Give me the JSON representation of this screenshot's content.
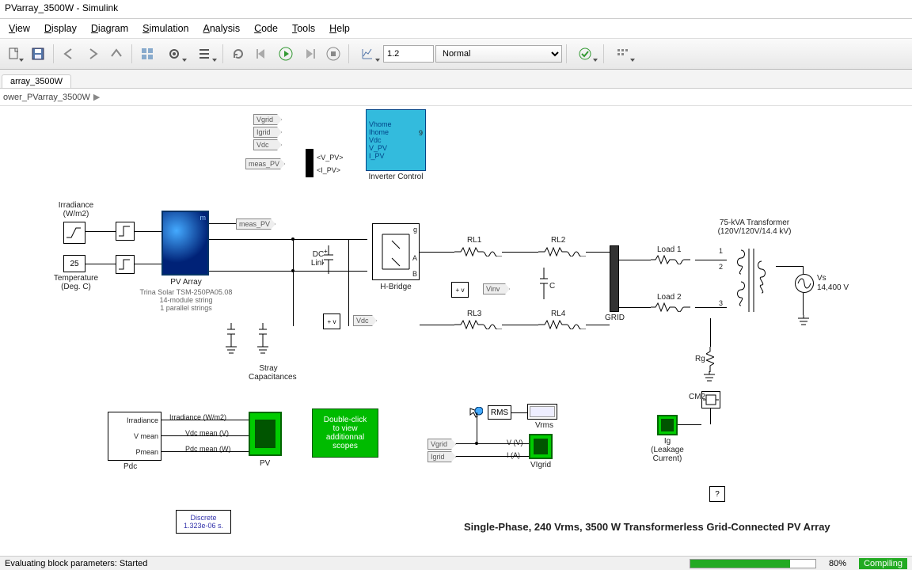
{
  "window": {
    "title": "PVarray_3500W - Simulink"
  },
  "menu": [
    "View",
    "Display",
    "Diagram",
    "Simulation",
    "Analysis",
    "Code",
    "Tools",
    "Help"
  ],
  "toolbar": {
    "stop_time": "1.2",
    "mode": "Normal"
  },
  "tab": "array_3500W",
  "breadcrumb": "ower_PVarray_3500W",
  "diagram": {
    "inverter_control": {
      "title": "Inverter Control",
      "ports_left": [
        "Vhome",
        "Ihome",
        "Vdc",
        "V_PV",
        "I_PV"
      ],
      "note": "9"
    },
    "bus_sel": [
      "<V_PV>",
      "<I_PV>"
    ],
    "from_tags_top": [
      "Vgrid",
      "Igrid",
      "Vdc",
      "meas_PV"
    ],
    "irr": {
      "label": "Irradiance\n(W/m2)"
    },
    "temp_const": "25",
    "temp_label": "Temperature\n(Deg. C)",
    "pv": {
      "title": "PV Array",
      "sub": "Trina Solar TSM-250PA05.08\n14-module string\n1 parallel strings",
      "m": "m"
    },
    "goto_meas": "meas_PV",
    "goto_vdc": "Vdc",
    "goto_vinv": "Vinv",
    "dc_link": "DC\nLink",
    "stray": "Stray\nCapacitances",
    "hbridge": {
      "title": "H-Bridge",
      "g": "g",
      "A": "A",
      "B": "B"
    },
    "rl": [
      "RL1",
      "RL2",
      "RL3",
      "RL4"
    ],
    "C": "C",
    "grid": "GRID",
    "loads": [
      "Load 1",
      "Load 2"
    ],
    "xfmr": {
      "title": "75-kVA Transformer\n(120V/120V/14.4 kV)",
      "ports": [
        "1",
        "2",
        "3"
      ]
    },
    "vs": {
      "name": "Vs",
      "v": "14,400 V"
    },
    "rg": "Rg",
    "cm2": "CM2",
    "pdc": {
      "title": "Pdc",
      "rows": [
        "Irradiance",
        "V mean",
        "Pmean"
      ],
      "outs": [
        "Irradiance (W/m2)",
        "Vdc mean (V)",
        "Pdc mean (W)"
      ]
    },
    "pv_scope": "PV",
    "info": "Double-click\nto view\nadditionnal\nscopes",
    "rms": {
      "box": "RMS",
      "out": "Vrms"
    },
    "vigrid": {
      "from": [
        "Vgrid",
        "Igrid"
      ],
      "sig": [
        "V (V)",
        "I (A)"
      ],
      "title": "VIgrid"
    },
    "ig": {
      "title": "Ig\n(Leakage\nCurrent)"
    },
    "help": "?",
    "powergui": "Discrete\n1.323e-06 s.",
    "caption": "Single-Phase, 240 Vrms, 3500 W Transformerless Grid-Connected PV Array"
  },
  "status": {
    "left": "Evaluating block parameters: Started",
    "pct": "80%",
    "mode": "Compiling"
  }
}
